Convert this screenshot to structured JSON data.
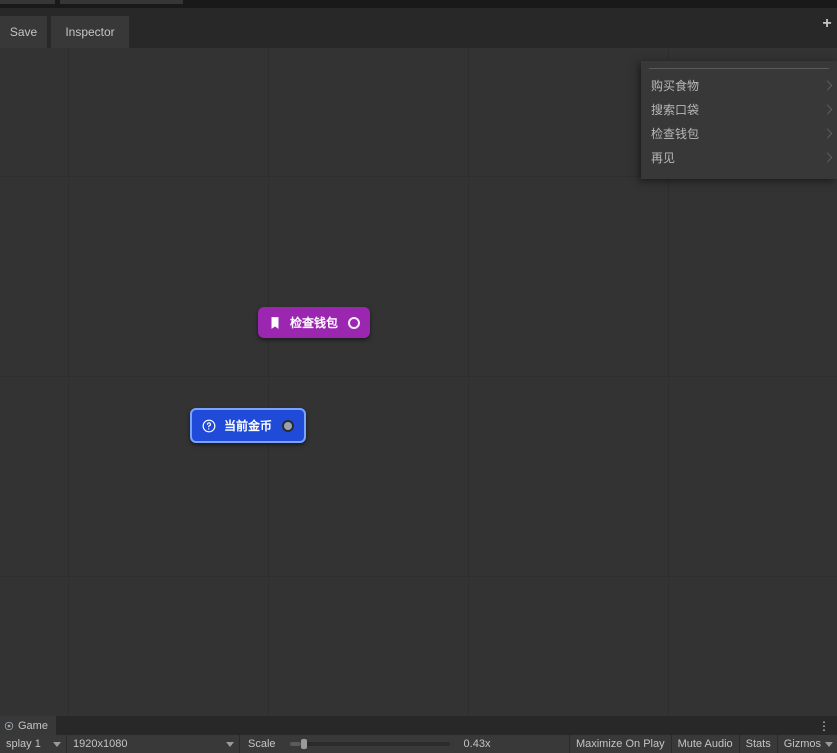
{
  "tabs": {
    "save": "Save",
    "inspector": "Inspector"
  },
  "search_panel": {
    "items": [
      "购买食物",
      "搜索口袋",
      "检查钱包",
      "再见"
    ]
  },
  "nodes": {
    "purple": {
      "label": "检查钱包",
      "icon": "bookmark-icon"
    },
    "blue": {
      "label": "当前金币",
      "icon": "question-icon"
    }
  },
  "game_tab": {
    "label": "Game"
  },
  "bottom": {
    "display": "splay 1",
    "resolution": "1920x1080",
    "scale_label": "Scale",
    "scale_value": "0.43x",
    "maximize": "Maximize On Play",
    "mute": "Mute Audio",
    "stats": "Stats",
    "gizmos": "Gizmos"
  }
}
